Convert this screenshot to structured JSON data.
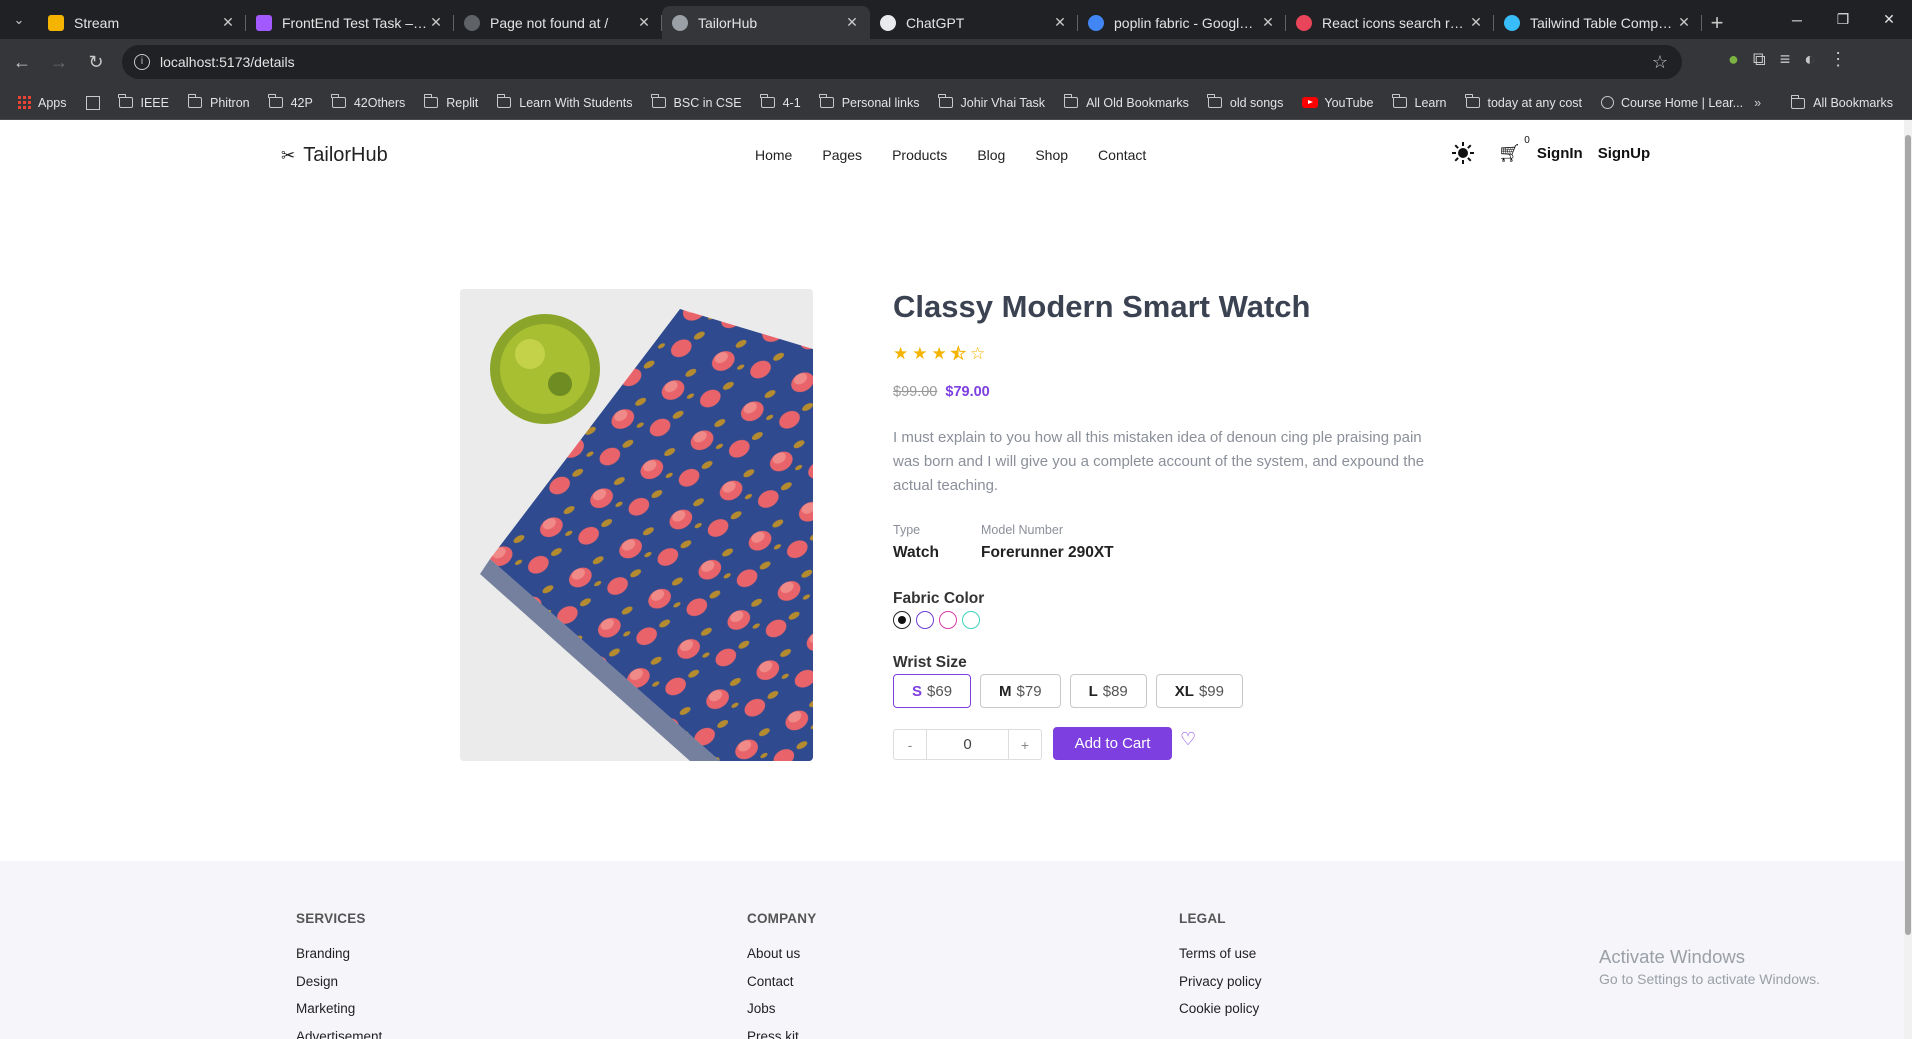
{
  "browser": {
    "tabs": [
      {
        "title": "Stream",
        "favicon_color": "#f4b400"
      },
      {
        "title": "FrontEnd Test Task – Figm",
        "favicon_color": "#a259ff"
      },
      {
        "title": "Page not found at /",
        "favicon_color": "#5f6368"
      },
      {
        "title": "TailorHub",
        "favicon_color": "#9aa0a6",
        "active": true
      },
      {
        "title": "ChatGPT",
        "favicon_color": "#e8eaed"
      },
      {
        "title": "poplin fabric - Google Sea",
        "favicon_color": "#4285f4"
      },
      {
        "title": "React icons search results",
        "favicon_color": "#e8455a"
      },
      {
        "title": "Tailwind Table Componen",
        "favicon_color": "#38bdf8"
      }
    ],
    "url": "localhost:5173/details",
    "bookmarks": [
      "IEEE",
      "Phitron",
      "42P",
      "42Others",
      "Replit",
      "Learn With Students",
      "BSC in CSE",
      "4-1",
      "Personal links",
      "Johir Vhai Task",
      "All Old Bookmarks",
      "old songs",
      "YouTube",
      "Learn",
      "today at any cost",
      "Course Home | Lear..."
    ],
    "apps_label": "Apps",
    "all_bookmarks": "All Bookmarks"
  },
  "site": {
    "logo": "TailorHub",
    "menu": [
      "Home",
      "Pages",
      "Products",
      "Blog",
      "Shop",
      "Contact"
    ],
    "cart_count": "0",
    "signin": "SignIn",
    "signup": "SignUp"
  },
  "product": {
    "title": "Classy Modern Smart Watch",
    "rating": 3.5,
    "rating_max": 5,
    "old_price": "$99.00",
    "price": "$79.00",
    "description": "I must explain to you how all this mistaken idea of denoun cing ple praising pain was born and I will give you a complete account of the system, and expound the actual teaching.",
    "type_label": "Type",
    "type_value": "Watch",
    "model_label": "Model Number",
    "model_value": "Forerunner 290XT",
    "color_label": "Fabric Color",
    "colors": [
      "#222222",
      "#6c3fd1",
      "#d63fa8",
      "#3fd1c0"
    ],
    "size_label": "Wrist Size",
    "sizes": [
      {
        "size": "S",
        "price": "$69"
      },
      {
        "size": "M",
        "price": "$79"
      },
      {
        "size": "L",
        "price": "$89"
      },
      {
        "size": "XL",
        "price": "$99"
      }
    ],
    "qty_minus": "-",
    "quantity": "0",
    "qty_plus": "+",
    "add_to_cart": "Add to Cart"
  },
  "footer": {
    "services": {
      "title": "SERVICES",
      "links": [
        "Branding",
        "Design",
        "Marketing",
        "Advertisement"
      ]
    },
    "company": {
      "title": "COMPANY",
      "links": [
        "About us",
        "Contact",
        "Jobs",
        "Press kit"
      ]
    },
    "legal": {
      "title": "LEGAL",
      "links": [
        "Terms of use",
        "Privacy policy",
        "Cookie policy"
      ]
    }
  },
  "watermark": {
    "title": "Activate Windows",
    "subtitle": "Go to Settings to activate Windows."
  },
  "colors": {
    "accent": "#7e3fe0",
    "star": "#f5b400"
  }
}
